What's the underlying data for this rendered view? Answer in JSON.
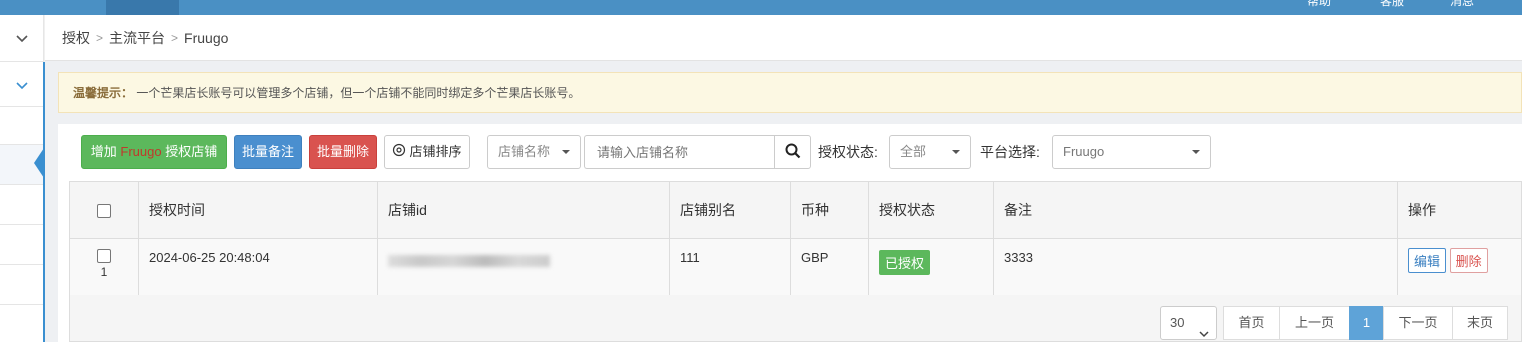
{
  "topbar": {
    "links": [
      "帮助",
      "客服",
      "消息"
    ]
  },
  "breadcrumb": {
    "items": [
      "授权",
      "主流平台",
      "Fruugo"
    ]
  },
  "tip": {
    "title": "温馨提示：",
    "text": "一个芒果店长账号可以管理多个店铺，但一个店铺不能同时绑定多个芒果店长账号。"
  },
  "toolbar": {
    "add_prefix": "增加",
    "add_platform": "Fruugo",
    "add_suffix": "授权店铺",
    "batch_note": "批量备注",
    "batch_delete": "批量删除",
    "sort": "店铺排序",
    "name_select": "店铺名称",
    "search_placeholder": "请输入店铺名称",
    "status_label": "授权状态:",
    "status_value": "全部",
    "platform_label": "平台选择:",
    "platform_value": "Fruugo"
  },
  "table": {
    "headers": [
      "授权时间",
      "店铺id",
      "店铺别名",
      "币种",
      "授权状态",
      "备注",
      "操作"
    ],
    "rows": [
      {
        "index": "1",
        "time": "2024-06-25 20:48:04",
        "alias": "111",
        "currency": "GBP",
        "status": "已授权",
        "note": "3333",
        "edit": "编辑",
        "delete": "删除"
      }
    ]
  },
  "pagination": {
    "page_size": "30",
    "first": "首页",
    "prev": "上一页",
    "current": "1",
    "next": "下一页",
    "last": "末页"
  },
  "colors": {
    "topbar": "#4a90c4",
    "success": "#5cb85c",
    "primary": "#4a8fcf",
    "danger": "#d9534f",
    "warning_bg": "#fcf8e3"
  }
}
